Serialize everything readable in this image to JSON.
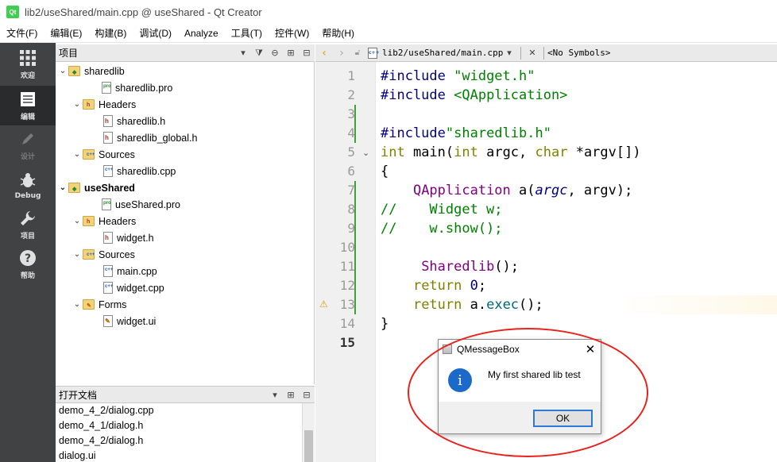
{
  "window": {
    "title": "lib2/useShared/main.cpp @ useShared - Qt Creator",
    "app_icon": "qt-icon"
  },
  "menu": [
    "文件(F)",
    "编辑(E)",
    "构建(B)",
    "调试(D)",
    "Analyze",
    "工具(T)",
    "控件(W)",
    "帮助(H)"
  ],
  "modes": [
    {
      "label": "欢迎",
      "icon": "grid-icon",
      "state": "normal"
    },
    {
      "label": "编辑",
      "icon": "document-icon",
      "state": "active"
    },
    {
      "label": "设计",
      "icon": "pen-icon",
      "state": "disabled"
    },
    {
      "label": "Debug",
      "icon": "bug-icon",
      "state": "normal"
    },
    {
      "label": "项目",
      "icon": "wrench-icon",
      "state": "normal"
    },
    {
      "label": "帮助",
      "icon": "help-icon",
      "state": "normal"
    }
  ],
  "projects": {
    "title": "项目",
    "tree": [
      {
        "label": "sharedlib"
      },
      {
        "label": "sharedlib.pro"
      },
      {
        "label": "Headers"
      },
      {
        "label": "sharedlib.h"
      },
      {
        "label": "sharedlib_global.h"
      },
      {
        "label": "Sources"
      },
      {
        "label": "sharedlib.cpp"
      },
      {
        "label": "useShared"
      },
      {
        "label": "useShared.pro"
      },
      {
        "label": "Headers"
      },
      {
        "label": "widget.h"
      },
      {
        "label": "Sources"
      },
      {
        "label": "main.cpp"
      },
      {
        "label": "widget.cpp"
      },
      {
        "label": "Forms"
      },
      {
        "label": "widget.ui"
      }
    ]
  },
  "open_docs": {
    "title": "打开文档",
    "items": [
      "demo_4_2/dialog.cpp",
      "demo_4_1/dialog.h",
      "demo_4_2/dialog.h",
      "dialog.ui"
    ]
  },
  "editor": {
    "file": "lib2/useShared/main.cpp",
    "symbols": "<No Symbols>",
    "line_numbers": [
      "1",
      "2",
      "3",
      "4",
      "5",
      "6",
      "7",
      "8",
      "9",
      "10",
      "11",
      "12",
      "13",
      "14",
      "15"
    ],
    "code": {
      "l1a": "#include ",
      "l1b": "\"widget.h\"",
      "l2a": "#include ",
      "l2b": "<QApplication>",
      "l4a": "#include",
      "l4b": "\"sharedlib.h\"",
      "l5a": "int",
      "l5b": " main(",
      "l5c": "int",
      "l5d": " argc, ",
      "l5e": "char",
      "l5f": " *argv[])",
      "l6": "{",
      "l7a": "    ",
      "l7b": "QApplication",
      "l7c": " a(",
      "l7d": "argc",
      "l7e": ", argv);",
      "l8": "//    Widget w;",
      "l9": "//    w.show();",
      "l11a": "     ",
      "l11b": "Sharedlib",
      "l11c": "();",
      "l12a": "    ",
      "l12b": "return",
      "l12c": " ",
      "l12d": "0",
      "l12e": ";",
      "l13a": "    ",
      "l13b": "return",
      "l13c": " a.",
      "l13d": "exec",
      "l13e": "();",
      "l14": "}"
    }
  },
  "messagebox": {
    "title": "QMessageBox",
    "text": "My first shared lib test",
    "ok": "OK",
    "close": "✕",
    "info_glyph": "i"
  }
}
